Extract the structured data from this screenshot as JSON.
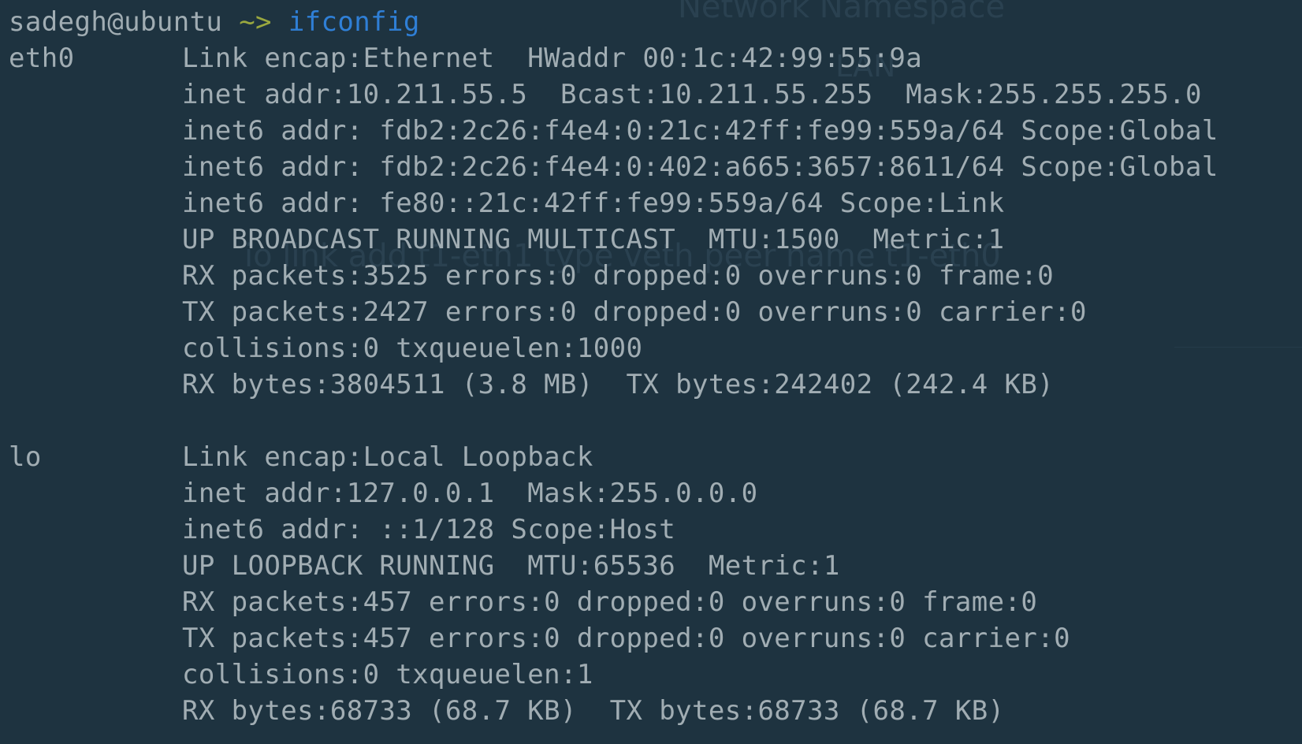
{
  "terminal": {
    "prompt": {
      "user_host": "sadegh@ubuntu",
      "path": "~>",
      "command": "ifconfig"
    },
    "interfaces": [
      {
        "name": "eth0",
        "lines": [
          "Link encap:Ethernet  HWaddr 00:1c:42:99:55:9a",
          "inet addr:10.211.55.5  Bcast:10.211.55.255  Mask:255.255.255.0",
          "inet6 addr: fdb2:2c26:f4e4:0:21c:42ff:fe99:559a/64 Scope:Global",
          "inet6 addr: fdb2:2c26:f4e4:0:402:a665:3657:8611/64 Scope:Global",
          "inet6 addr: fe80::21c:42ff:fe99:559a/64 Scope:Link",
          "UP BROADCAST RUNNING MULTICAST  MTU:1500  Metric:1",
          "RX packets:3525 errors:0 dropped:0 overruns:0 frame:0",
          "TX packets:2427 errors:0 dropped:0 overruns:0 carrier:0",
          "collisions:0 txqueuelen:1000",
          "RX bytes:3804511 (3.8 MB)  TX bytes:242402 (242.4 KB)"
        ]
      },
      {
        "name": "lo",
        "lines": [
          "Link encap:Local Loopback",
          "inet addr:127.0.0.1  Mask:255.0.0.0",
          "inet6 addr: ::1/128 Scope:Host",
          "UP LOOPBACK RUNNING  MTU:65536  Metric:1",
          "RX packets:457 errors:0 dropped:0 overruns:0 frame:0",
          "TX packets:457 errors:0 dropped:0 overruns:0 carrier:0",
          "collisions:0 txqueuelen:1",
          "RX bytes:68733 (68.7 KB)  TX bytes:68733 (68.7 KB)"
        ]
      }
    ]
  },
  "background_ghost_text": {
    "line1": "Network Namespace",
    "line2": "LAN",
    "line3": "io link add t1-eth1 type veth peer name t1-eth0"
  },
  "colors": {
    "background": "#1e3340",
    "text": "#a1adb3",
    "path": "#9aa83f",
    "command": "#2f7fd6"
  }
}
